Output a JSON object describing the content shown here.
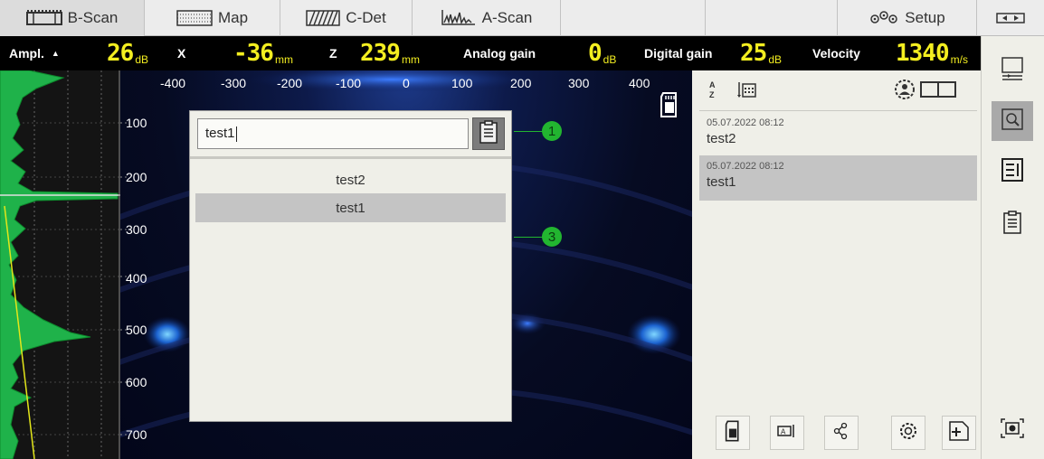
{
  "tabs": [
    {
      "label": "B-Scan",
      "icon": "bscan-icon",
      "active": true
    },
    {
      "label": "Map",
      "icon": "map-grid-icon",
      "active": false
    },
    {
      "label": "C-Det",
      "icon": "cdet-icon",
      "active": false
    },
    {
      "label": "A-Scan",
      "icon": "ascan-icon",
      "active": false
    },
    {
      "label": "Setup",
      "icon": "gears-icon",
      "active": false
    }
  ],
  "readout": {
    "ampl_label": "Ampl.",
    "ampl_value": "26",
    "ampl_unit": "dB",
    "x_label": "X",
    "x_value": "-36",
    "x_unit": "mm",
    "z_label": "Z",
    "z_value": "239",
    "z_unit": "mm",
    "analog_label": "Analog gain",
    "analog_value": "0",
    "analog_unit": "dB",
    "digital_label": "Digital gain",
    "digital_value": "25",
    "digital_unit": "dB",
    "velocity_label": "Velocity",
    "velocity_value": "1340",
    "velocity_unit": "m/s"
  },
  "scan": {
    "x_ticks": [
      "-400",
      "-300",
      "-200",
      "-100",
      "0",
      "100",
      "200",
      "300",
      "400"
    ],
    "depth_ticks": [
      "100",
      "200",
      "300",
      "400",
      "500",
      "600",
      "700"
    ]
  },
  "popup": {
    "search_value": "test1",
    "items": [
      {
        "label": "test2",
        "selected": false
      },
      {
        "label": "test1",
        "selected": true
      }
    ],
    "callout_1": "1",
    "callout_2": "3"
  },
  "files": [
    {
      "date": "05.07.2022 08:12",
      "name": "test2",
      "selected": false
    },
    {
      "date": "05.07.2022 08:12",
      "name": "test1",
      "selected": true
    }
  ],
  "colors": {
    "readout_value": "#f3ee20",
    "selection": "#c4c4c4",
    "callout": "#22b530",
    "amplitude_fill": "#1fb24a"
  }
}
